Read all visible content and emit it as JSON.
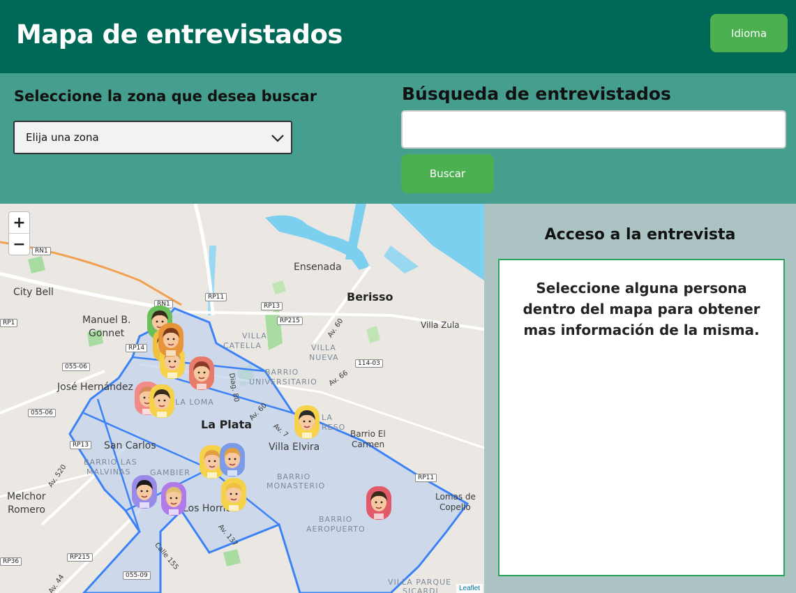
{
  "header": {
    "title": "Mapa de entrevistados",
    "language_button": "Idioma"
  },
  "zone_filter": {
    "label": "Seleccione la zona que desea buscar",
    "selected": "Elija una zona"
  },
  "search": {
    "label": "Búsqueda de entrevistados",
    "value": "",
    "button": "Buscar"
  },
  "map": {
    "zoom_in": "+",
    "zoom_out": "−",
    "attribution": "Leaflet",
    "labels": {
      "ensenada": "Ensenada",
      "berisso": "Berisso",
      "city_bell": "City Bell",
      "manuel_b_gonnet_1": "Manuel B.",
      "manuel_b_gonnet_2": "Gonnet",
      "jose_hernandez": "José Hernández",
      "la_plata": "La Plata",
      "san_carlos": "San Carlos",
      "villa_elvira": "Villa Elvira",
      "melchor_romero_1": "Melchor",
      "melchor_romero_2": "Romero",
      "villa_zula": "Villa Zula",
      "barrio_el_carmen_1": "Barrio El",
      "barrio_el_carmen_2": "Carmen",
      "lomas_de_copello_1": "Lomas de",
      "lomas_de_copello_2": "Copello",
      "los_hornos": "Los Hornos",
      "villa_catella_1": "VILLA",
      "villa_catella_2": "CATELLA",
      "villa_nueva_1": "VILLA",
      "villa_nueva_2": "NUEVA",
      "barrio_universitario_1": "BARRIO",
      "barrio_universitario_2": "UNIVERSITARIO",
      "la_loma": "LA LOMA",
      "barrio_las_malvinas_1": "BARRIO LAS",
      "barrio_las_malvinas_2": "MALVINAS",
      "gambier": "GAMBIER",
      "barrio_monasterio_1": "BARRIO",
      "barrio_monasterio_2": "MONASTERIO",
      "barrio_aeropuerto_1": "BARRIO",
      "barrio_aeropuerto_2": "AEROPUERTO",
      "villa_parque_sicardi_1": "VILLA PARQUE",
      "villa_parque_sicardi_2": "SICARDI",
      "la_progreso_1": "LA",
      "la_progreso_2": "RESO"
    },
    "roads": {
      "rn1": "RN1",
      "rn1b": "RN1",
      "rp11": "RP11",
      "rp13": "RP13",
      "rp13b": "RP13",
      "rp215": "RP215",
      "rp215b": "RP215",
      "rp14": "RP14",
      "r114": "114-03",
      "r055_06a": "055-06",
      "r055_06b": "055-06",
      "r055_09": "055-09",
      "rp36": "RP36",
      "rp11b": "RP11",
      "rp1": "RP1",
      "av60a": "Av. 60",
      "av66": "Av. 66",
      "av60b": "Av. 60",
      "av520": "Av. 520",
      "av44": "Av. 44",
      "diag80": "Diag. 80",
      "av137": "Av. 137",
      "calle155": "Calle 155",
      "av7": "Av. 7"
    },
    "marker_count": 14
  },
  "panel": {
    "title": "Acceso a la entrevista",
    "message": "Seleccione alguna persona dentro del mapa para obtener mas información de la misma."
  },
  "colors": {
    "header": "#006857",
    "controls": "#459e8e",
    "button": "#4caf50",
    "panel": "#abc4c3",
    "panel_border": "#28a55a",
    "district": "#3b82f6"
  }
}
